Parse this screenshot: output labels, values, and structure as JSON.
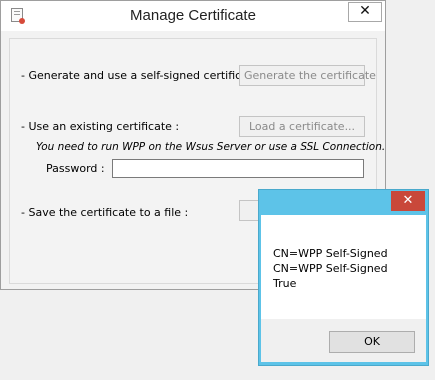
{
  "window": {
    "title": "Manage Certificate",
    "close_glyph": "✕"
  },
  "self_signed": {
    "label": "- Generate and use a self-signed certificate :",
    "button": "Generate the certificate"
  },
  "existing": {
    "label": "- Use an existing certificate :",
    "button": "Load a certificate...",
    "note": "You need to run WPP on the Wsus Server or use a SSL Connection.",
    "password_label": "Password :",
    "password_value": ""
  },
  "save": {
    "label": "- Save the certificate to a file :",
    "button": ""
  },
  "message_box": {
    "close_glyph": "✕",
    "lines": [
      "CN=WPP Self-Signed",
      "CN=WPP Self-Signed",
      "True"
    ],
    "ok_label": "OK"
  },
  "colors": {
    "msgbox_frame": "#5dc3e8",
    "msgbox_close": "#c9483a",
    "disabled_text": "#8a8a8a"
  }
}
